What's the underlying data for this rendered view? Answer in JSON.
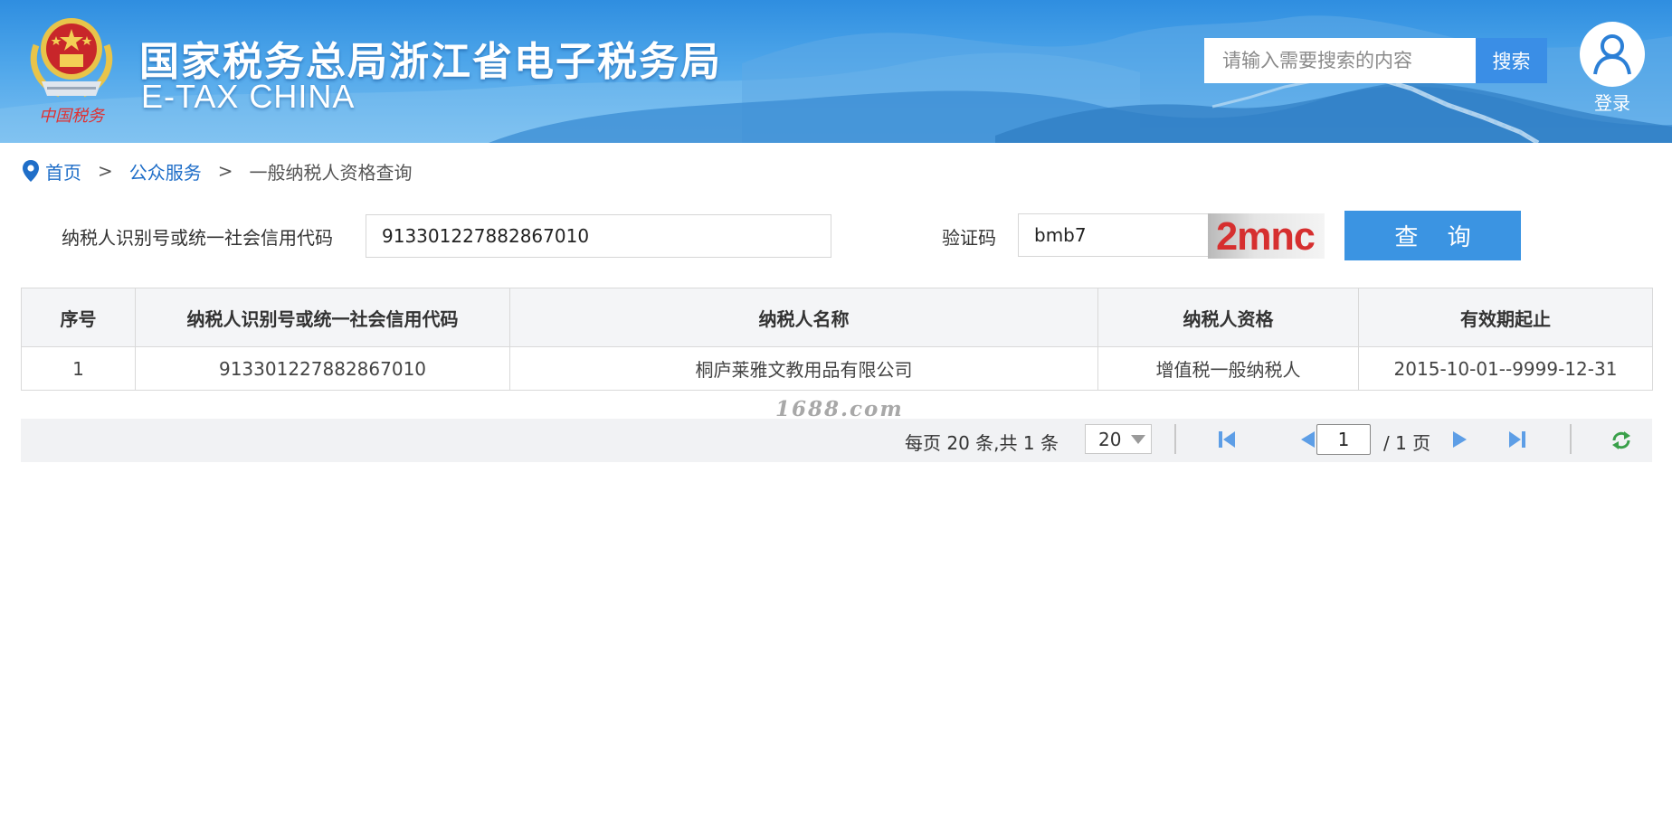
{
  "header": {
    "title": "国家税务总局浙江省电子税务局",
    "subtitle": "E-TAX CHINA",
    "emblem_icon": "tax-emblem-icon",
    "emblem_text": "中国税务",
    "search": {
      "placeholder": "请输入需要搜索的内容",
      "value": "",
      "button_label": "搜索"
    },
    "login_label": "登录"
  },
  "breadcrumb": {
    "icon": "location-pin-icon",
    "items": [
      "首页",
      "公众服务",
      "一般纳税人资格查询"
    ],
    "separator": ">"
  },
  "query_form": {
    "code_label": "纳税人识别号或统一社会信用代码",
    "code_value": "913301227882867010",
    "captcha_label": "验证码",
    "captcha_value": "bmb7",
    "captcha_image_text": "2mnc",
    "submit_label": "查 询"
  },
  "results": {
    "columns": [
      "序号",
      "纳税人识别号或统一社会信用代码",
      "纳税人名称",
      "纳税人资格",
      "有效期起止"
    ],
    "rows": [
      [
        "1",
        "913301227882867010",
        "桐庐莱雅文教用品有限公司",
        "增值税一般纳税人",
        "2015-10-01--9999-12-31"
      ]
    ]
  },
  "pagination": {
    "per_page_text": "每页 20 条,共 1 条",
    "page_size": "20",
    "current_page": "1",
    "total_pages_text": "/ 1 页"
  },
  "watermark": "1688.com",
  "colors": {
    "header_blue": "#2f8ee0",
    "link_blue": "#1f6ec8",
    "button_blue": "#3b94e2",
    "captcha_red": "#d62f2f",
    "pager_blue": "#5d9ee6",
    "refresh_green": "#3aa04a"
  }
}
